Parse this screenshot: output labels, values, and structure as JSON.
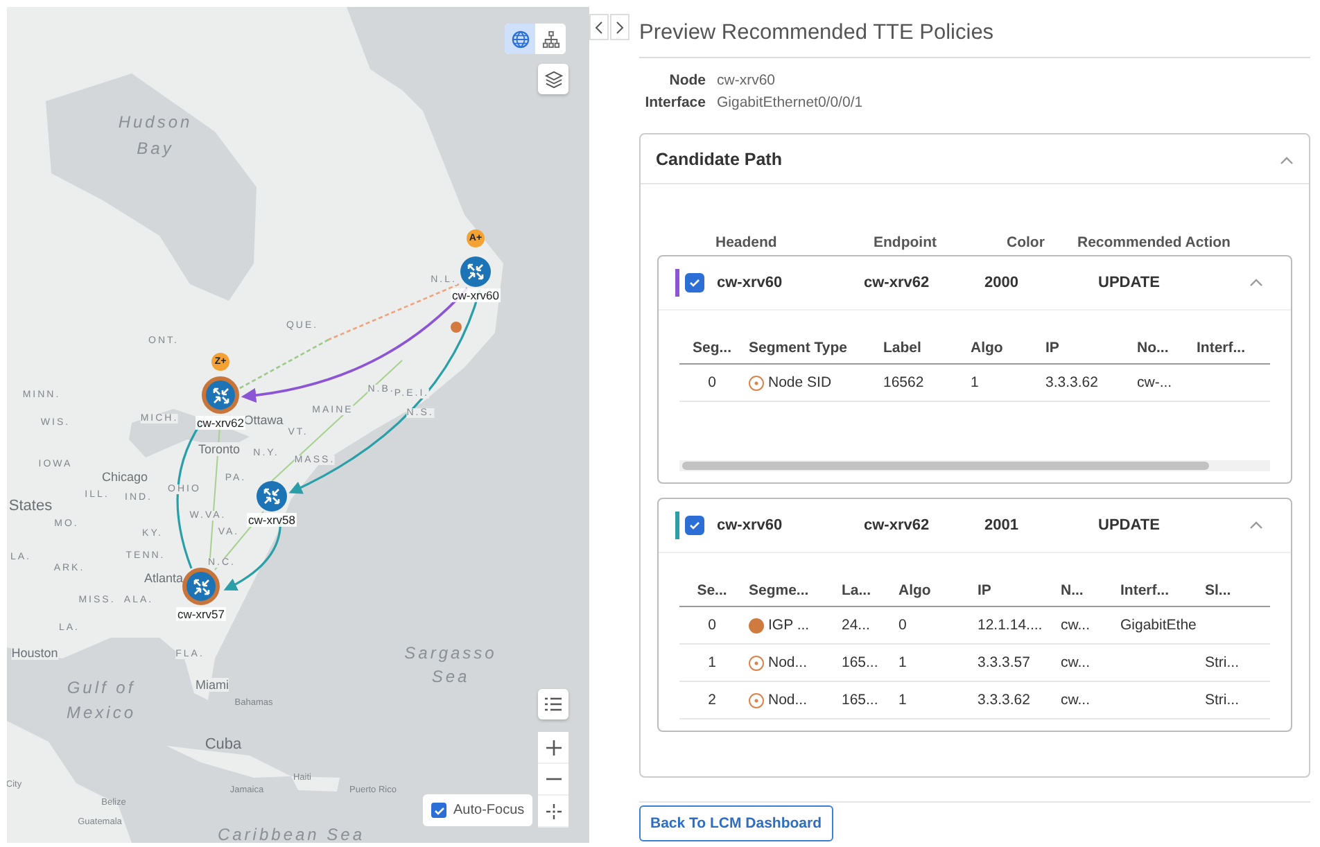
{
  "map": {
    "labels": [
      {
        "text": "Hudson",
        "kind": "water"
      },
      {
        "text": "Bay",
        "kind": "water"
      },
      {
        "text": "ONT.",
        "kind": "region"
      },
      {
        "text": "QUE.",
        "kind": "region"
      },
      {
        "text": "N.L.",
        "kind": "region"
      },
      {
        "text": "MINN.",
        "kind": "region"
      },
      {
        "text": "WIS.",
        "kind": "region"
      },
      {
        "text": "MICH.",
        "kind": "region"
      },
      {
        "text": "Ottawa",
        "kind": "city"
      },
      {
        "text": "N.B.",
        "kind": "region"
      },
      {
        "text": "P.E.I.",
        "kind": "region"
      },
      {
        "text": "MAINE",
        "kind": "region"
      },
      {
        "text": "N.S.",
        "kind": "region"
      },
      {
        "text": "VT.",
        "kind": "region"
      },
      {
        "text": "Toronto",
        "kind": "city"
      },
      {
        "text": "N.Y.",
        "kind": "region"
      },
      {
        "text": "MASS.",
        "kind": "region"
      },
      {
        "text": "IOWA",
        "kind": "region"
      },
      {
        "text": "Chicago",
        "kind": "city"
      },
      {
        "text": "PA.",
        "kind": "region"
      },
      {
        "text": "ILL.",
        "kind": "region"
      },
      {
        "text": "IND.",
        "kind": "region"
      },
      {
        "text": "OHIO",
        "kind": "region"
      },
      {
        "text": "States",
        "kind": "country"
      },
      {
        "text": "MO.",
        "kind": "region"
      },
      {
        "text": "W.VA.",
        "kind": "region"
      },
      {
        "text": "KY.",
        "kind": "region"
      },
      {
        "text": "VA.",
        "kind": "region"
      },
      {
        "text": "TENN.",
        "kind": "region"
      },
      {
        "text": "LA.",
        "kind": "region"
      },
      {
        "text": "ARK.",
        "kind": "region"
      },
      {
        "text": "N.C.",
        "kind": "region"
      },
      {
        "text": "Atlanta",
        "kind": "city"
      },
      {
        "text": "MISS.",
        "kind": "region"
      },
      {
        "text": "ALA.",
        "kind": "region"
      },
      {
        "text": "LA.",
        "kind": "region"
      },
      {
        "text": "Houston",
        "kind": "city"
      },
      {
        "text": "FLA.",
        "kind": "region"
      },
      {
        "text": "Sargasso",
        "kind": "water"
      },
      {
        "text": "Sea",
        "kind": "water"
      },
      {
        "text": "Gulf of",
        "kind": "water"
      },
      {
        "text": "Mexico",
        "kind": "water"
      },
      {
        "text": "Miami",
        "kind": "city"
      },
      {
        "text": "Bahamas",
        "kind": "small"
      },
      {
        "text": "Cuba",
        "kind": "country"
      },
      {
        "text": "City",
        "kind": "small"
      },
      {
        "text": "Haiti",
        "kind": "small"
      },
      {
        "text": "Jamaica",
        "kind": "small"
      },
      {
        "text": "Puerto Rico",
        "kind": "small"
      },
      {
        "text": "Belize",
        "kind": "small"
      },
      {
        "text": "Guatemala",
        "kind": "small"
      },
      {
        "text": "Caribbean Sea",
        "kind": "water"
      }
    ],
    "nodes": [
      {
        "name": "cw-xrv60",
        "badge": "A+",
        "highlighted": false
      },
      {
        "name": "cw-xrv62",
        "badge": "Z+",
        "highlighted": true
      },
      {
        "name": "cw-xrv58",
        "highlighted": false
      },
      {
        "name": "cw-xrv57",
        "highlighted": true
      }
    ],
    "view_toggle": [
      {
        "kind": "globe",
        "selected": true
      },
      {
        "kind": "tree",
        "selected": false
      }
    ],
    "auto_focus": {
      "label": "Auto-Focus",
      "checked": true
    }
  },
  "panel": {
    "title": "Preview Recommended TTE Policies",
    "details": [
      {
        "label": "Node",
        "value": "cw-xrv60"
      },
      {
        "label": "Interface",
        "value": "GigabitEthernet0/0/0/1"
      }
    ],
    "candidate_path": {
      "title": "Candidate Path",
      "expanded": true,
      "columns": [
        "Headend",
        "Endpoint",
        "Color",
        "Recommended Action"
      ],
      "policies": [
        {
          "headend": "cw-xrv60",
          "endpoint": "cw-xrv62",
          "color_value": "2000",
          "action": "UPDATE",
          "checked": true,
          "expanded": true,
          "color": "#8b55d6",
          "scrollbar": true,
          "columns": [
            "Seg...",
            "Segment Type",
            "Label",
            "Algo",
            "IP",
            "No...",
            "Interf..."
          ],
          "rows": [
            {
              "kind": "hollow",
              "cells": [
                "0",
                "Node SID",
                "16562",
                "1",
                "3.3.3.62",
                "cw-...",
                null
              ]
            }
          ]
        },
        {
          "headend": "cw-xrv60",
          "endpoint": "cw-xrv62",
          "color_value": "2001",
          "action": "UPDATE",
          "checked": true,
          "expanded": true,
          "color": "#2a9fa8",
          "scrollbar": false,
          "columns": [
            "Se...",
            "Segme...",
            "La...",
            "Algo",
            "IP",
            "N...",
            "Interf...",
            "Sl..."
          ],
          "rows": [
            {
              "kind": "filled",
              "cells": [
                "0",
                "IGP ...",
                "24...",
                "0",
                "12.1.14....",
                "cw...",
                "GigabitEthe",
                null
              ]
            },
            {
              "kind": "hollow",
              "cells": [
                "1",
                "Nod...",
                "165...",
                "1",
                "3.3.3.57",
                "cw...",
                null,
                "Stri..."
              ]
            },
            {
              "kind": "hollow",
              "cells": [
                "2",
                "Nod...",
                "165...",
                "1",
                "3.3.3.62",
                "cw...",
                null,
                "Stri..."
              ]
            }
          ]
        }
      ]
    },
    "back_button": "Back To LCM Dashboard"
  }
}
